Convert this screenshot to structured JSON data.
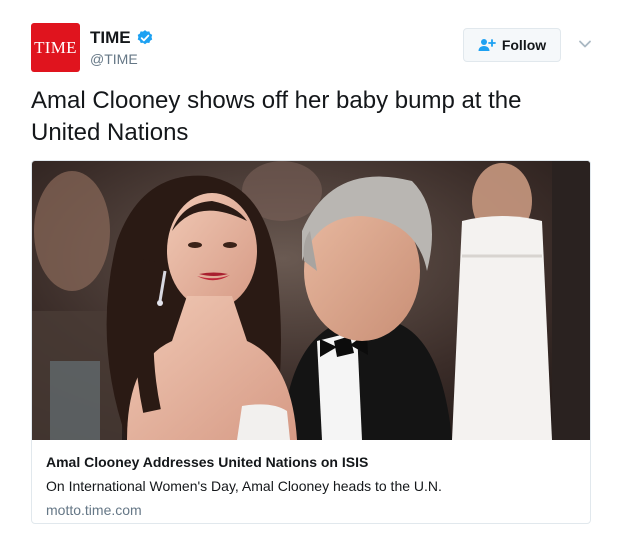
{
  "account": {
    "avatar_text": "TIME",
    "display_name": "TIME",
    "handle": "@TIME",
    "verified": true,
    "avatar_color": "#e0141e",
    "verified_color": "#1da1f2"
  },
  "actions": {
    "follow_label": "Follow",
    "follow_icon": "add-user-icon",
    "menu_icon": "chevron-down-icon"
  },
  "tweet": {
    "text": "Amal Clooney shows off her baby bump at the United Nations"
  },
  "card": {
    "image_icon": "photo",
    "title": "Amal Clooney Addresses United Nations on ISIS",
    "description": "On International Women's Day, Amal Clooney heads to the U.N.",
    "domain": "motto.time.com"
  }
}
